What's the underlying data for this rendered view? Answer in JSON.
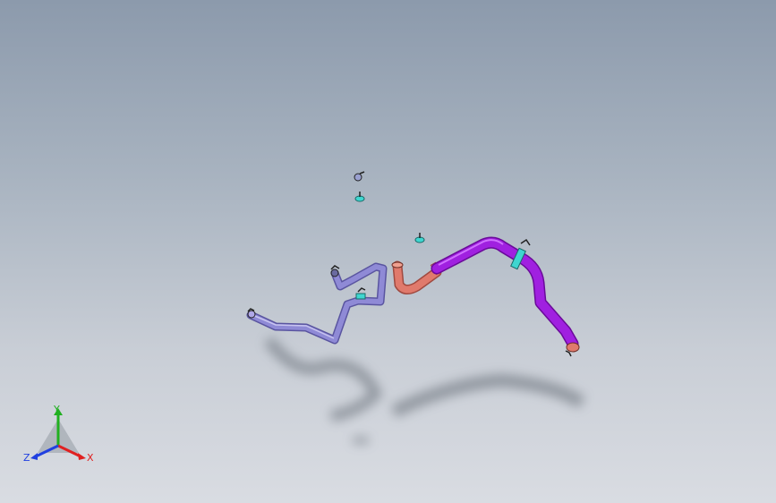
{
  "viewport": {
    "background_top": "#8c9aac",
    "background_bottom": "#d9dce2"
  },
  "model": {
    "colors": {
      "hose_light": "#8f8ad6",
      "hose_purple": "#a020e0",
      "hose_salmon": "#e07a6c",
      "clamp_cyan": "#3fd6d0",
      "shadow": "#5f6670"
    }
  },
  "triad": {
    "x_label": "X",
    "y_label": "Y",
    "z_label": "Z",
    "x_color": "#e02020",
    "y_color": "#20b020",
    "z_color": "#2040e0"
  }
}
